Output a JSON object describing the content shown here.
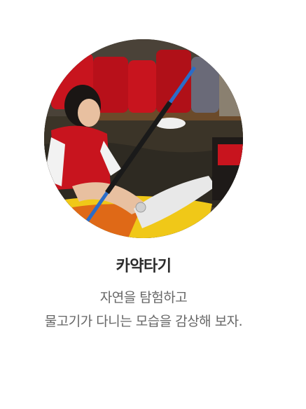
{
  "card": {
    "title": "카약타기",
    "description_lines": [
      "자연을 탐험하고",
      "물고기가 다니는 모습을 감상해 보자."
    ]
  },
  "colors": {
    "title": "#2b2b2b",
    "description": "#666666",
    "life_vest_red": "#c8141e",
    "kayak_yellow": "#f0c818",
    "paddle_blue": "#2a6cc8"
  }
}
